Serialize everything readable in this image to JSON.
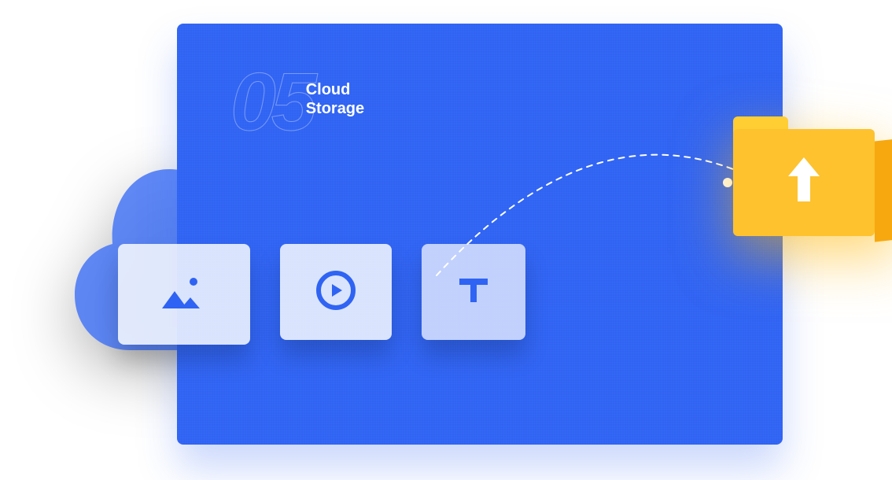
{
  "header": {
    "number": "05",
    "title_line1": "Cloud",
    "title_line2": "Storage"
  },
  "tiles": {
    "photo": "photo-icon",
    "video": "video-icon",
    "text": "text-icon"
  },
  "upload": {
    "label": "upload-arrow-icon"
  }
}
